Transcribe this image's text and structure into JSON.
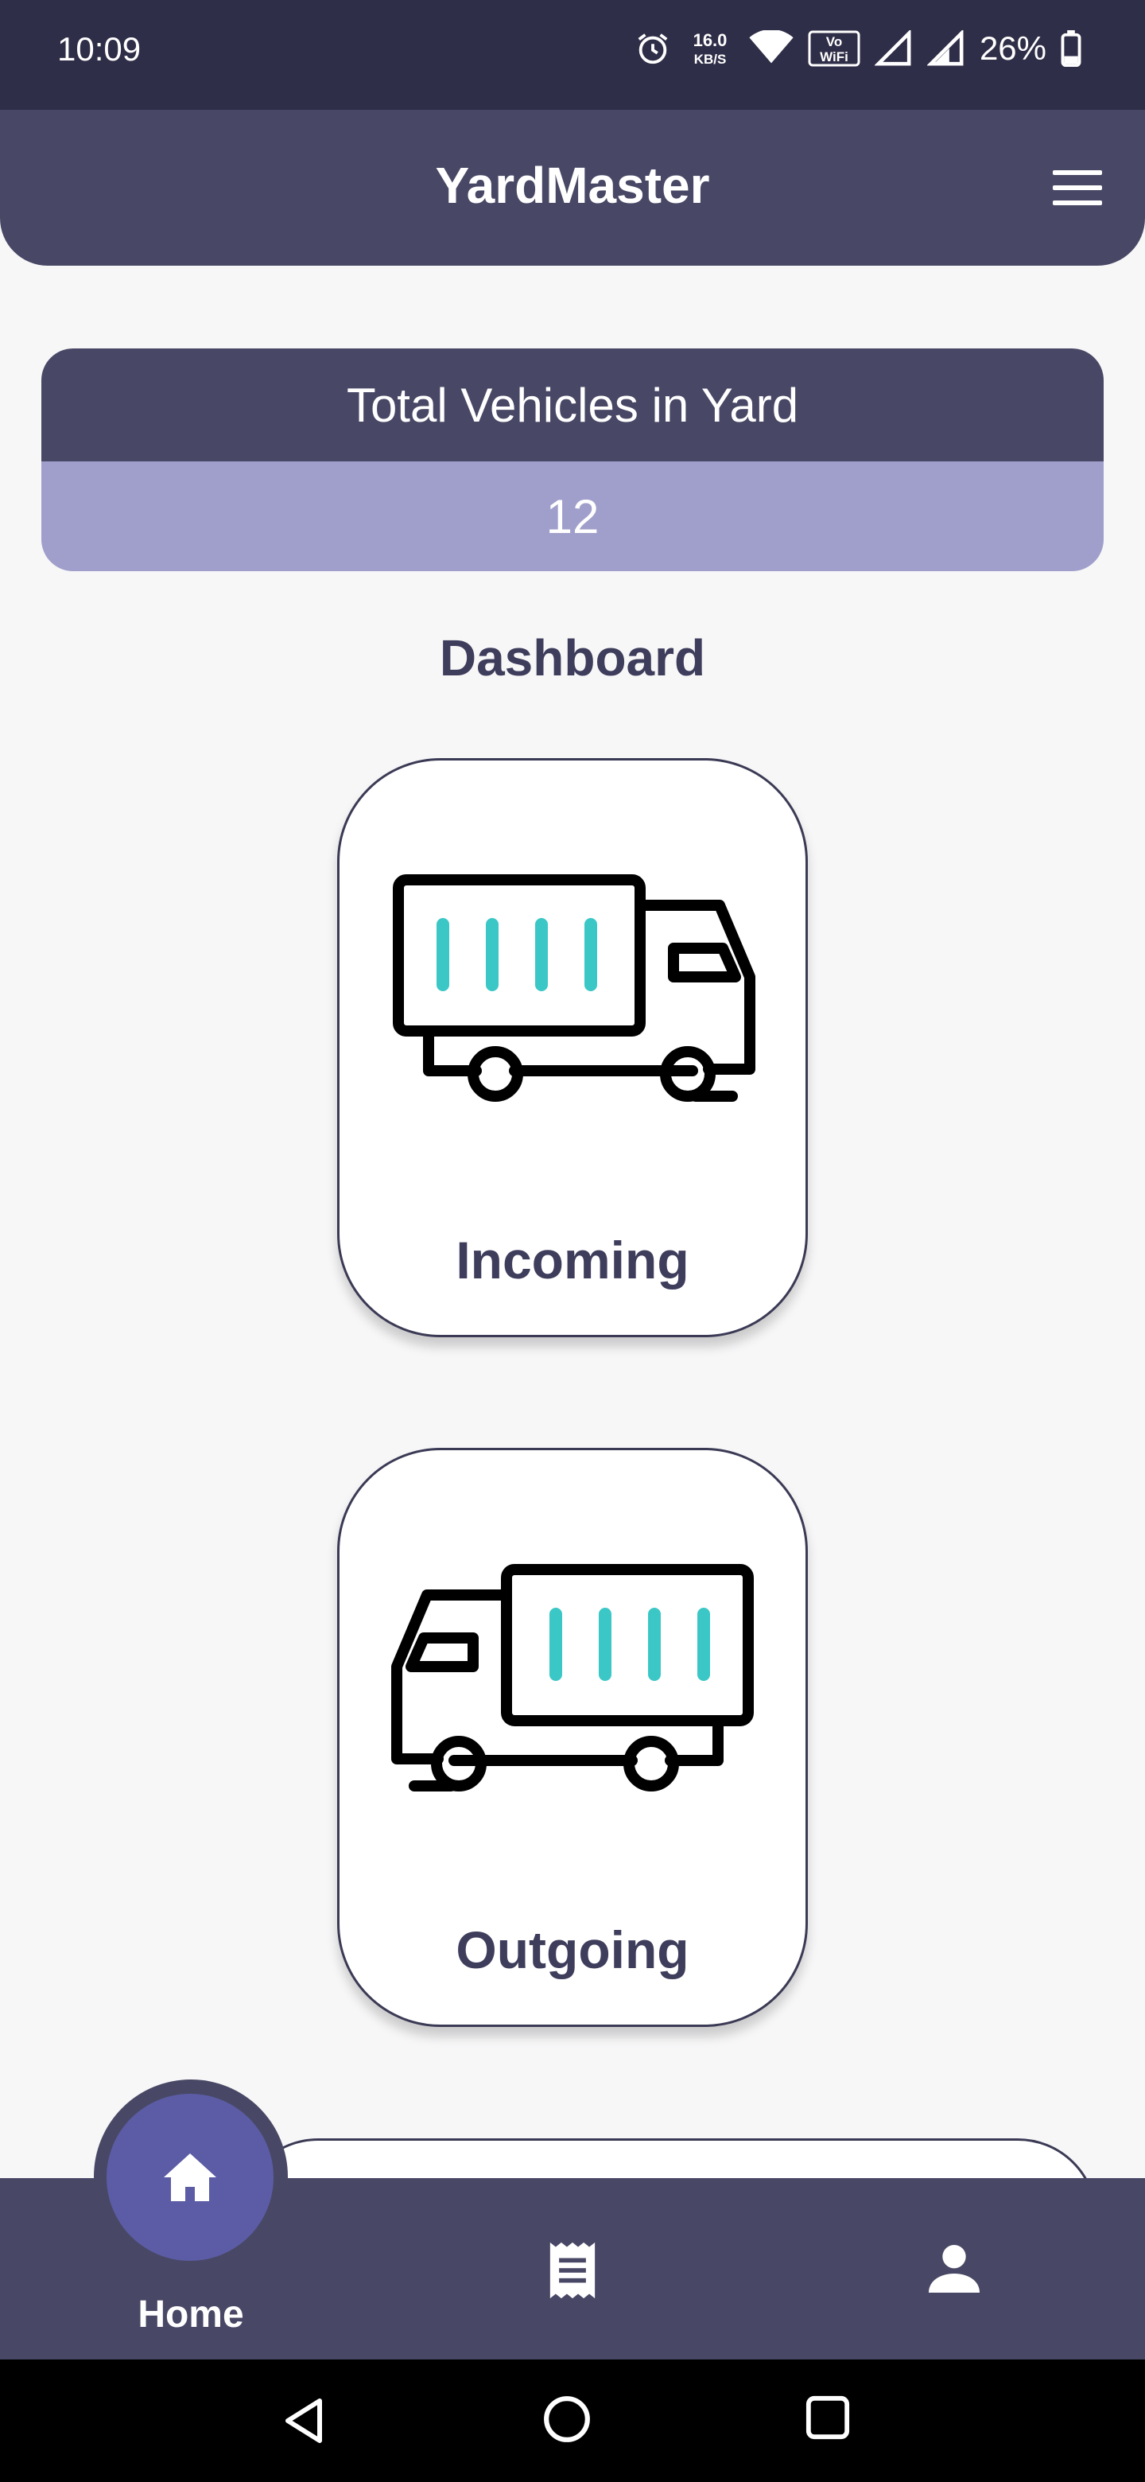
{
  "status_bar": {
    "time": "10:09",
    "speed": "16.0",
    "speed_unit": "KB/S",
    "vowifi_top": "Vo",
    "vowifi_bottom": "WiFi",
    "battery": "26%"
  },
  "app_bar": {
    "title": "YardMaster",
    "menu_icon": "hamburger-menu-icon"
  },
  "summary": {
    "label": "Total Vehicles in Yard",
    "value": "12"
  },
  "dashboard": {
    "title": "Dashboard",
    "tiles": [
      {
        "label": "Incoming",
        "icon": "incoming-truck-icon"
      },
      {
        "label": "Outgoing",
        "icon": "outgoing-truck-icon"
      }
    ]
  },
  "bottom_nav": {
    "items": [
      {
        "label": "Home",
        "icon": "home-icon",
        "active": true
      },
      {
        "label": "",
        "icon": "receipt-icon",
        "active": false
      },
      {
        "label": "",
        "icon": "person-icon",
        "active": false
      }
    ]
  },
  "colors": {
    "status_bar": "#2f2e48",
    "primary": "#484866",
    "summary_value_bg": "#a09fcb",
    "home_button": "#5c5ca6",
    "truck_stripes": "#3cc7c7",
    "background": "#f7f7f8"
  }
}
